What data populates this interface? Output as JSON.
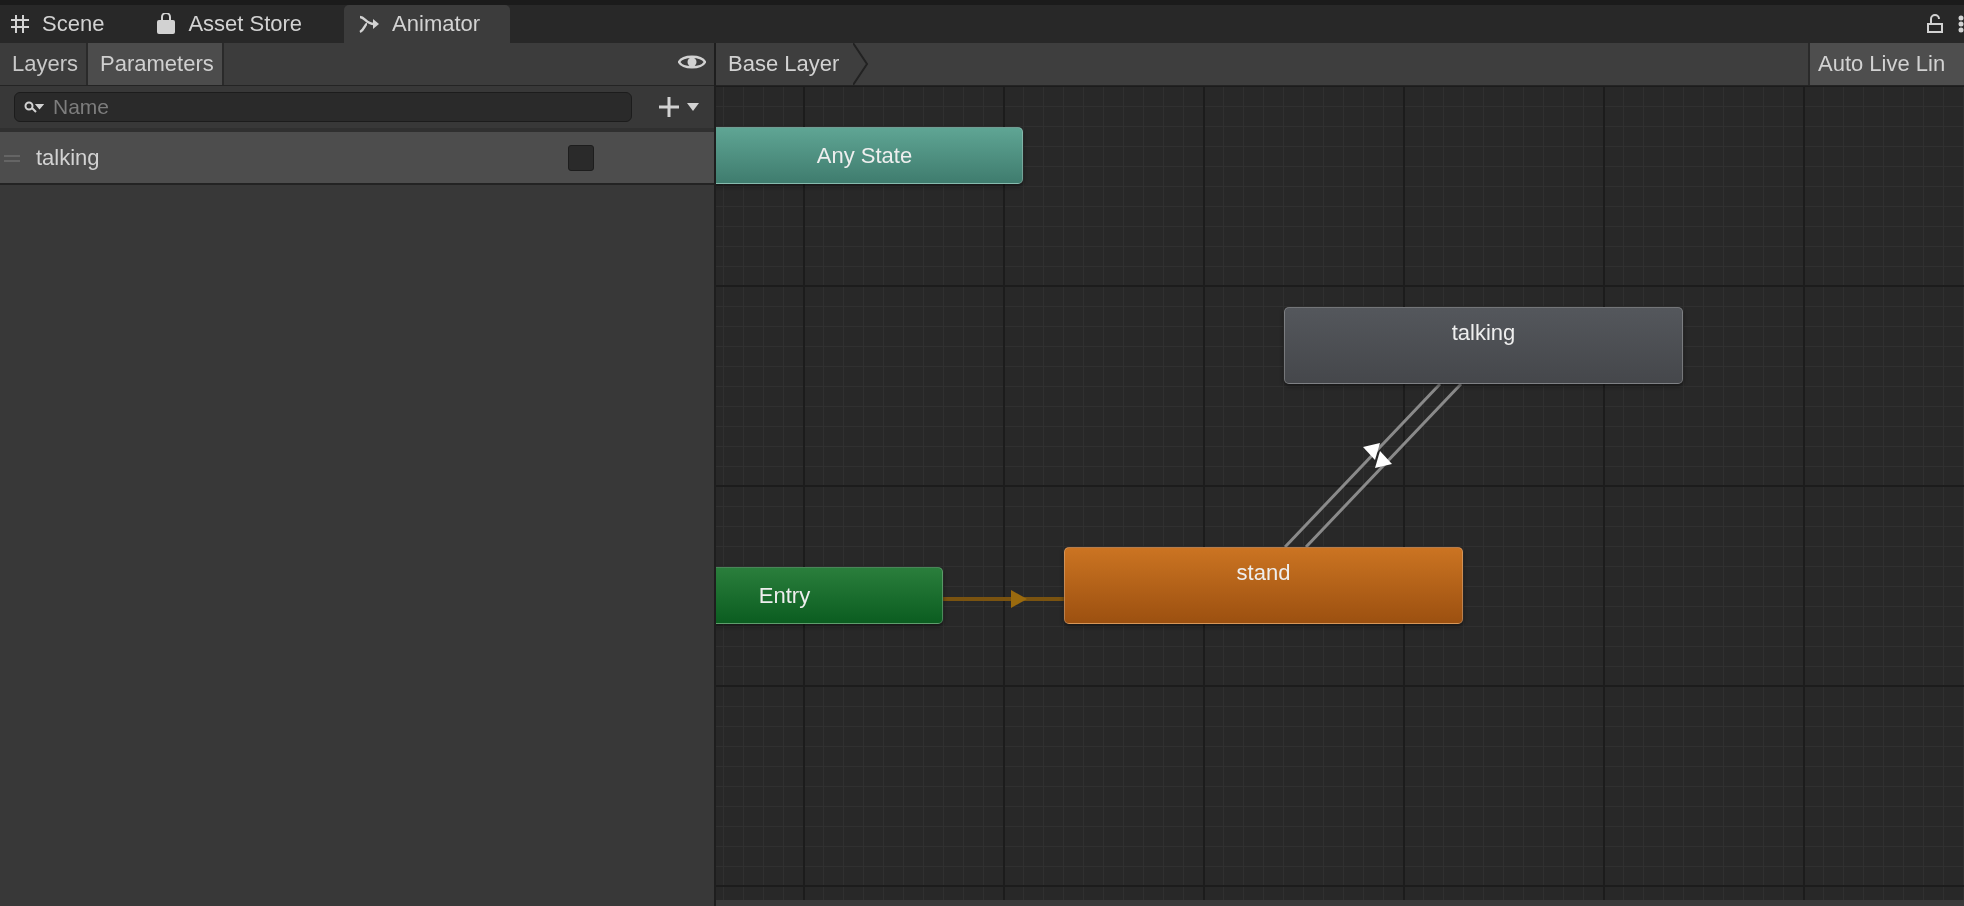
{
  "tabs": [
    {
      "label": "Scene",
      "kind": "grid",
      "selected": false
    },
    {
      "label": "Asset Store",
      "kind": "bag",
      "selected": false
    },
    {
      "label": "Animator",
      "kind": "branch",
      "selected": true
    }
  ],
  "panel_tabs": [
    {
      "label": "Layers",
      "selected": false
    },
    {
      "label": "Parameters",
      "selected": true
    }
  ],
  "search": {
    "placeholder": "Name"
  },
  "parameters": [
    {
      "name": "talking",
      "checked": false
    }
  ],
  "breadcrumb": "Base Layer",
  "live_link_button": "Auto Live Lin",
  "states": [
    {
      "label": "Any State",
      "kind": "any"
    },
    {
      "label": "talking",
      "kind": "normal"
    },
    {
      "label": "Entry",
      "kind": "entry"
    },
    {
      "label": "stand",
      "kind": "default"
    }
  ]
}
